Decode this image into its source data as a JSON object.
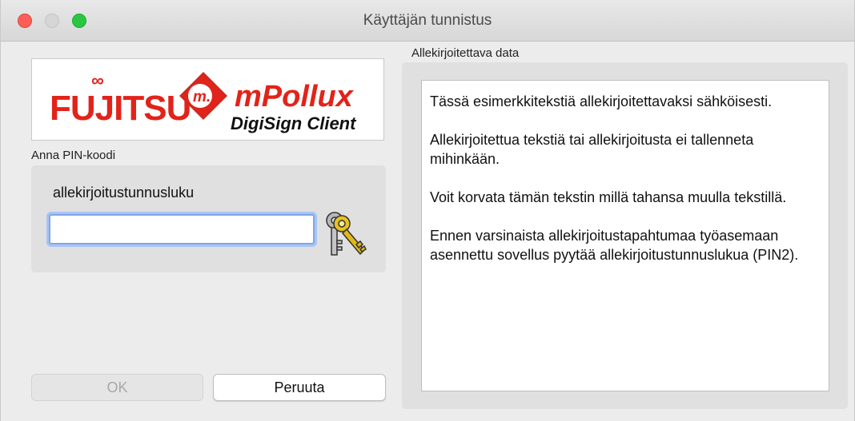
{
  "window": {
    "title": "Käyttäjän tunnistus"
  },
  "logo": {
    "fujitsu": "FUJITSU",
    "product_name": "mPollux",
    "product_sub": "DigiSign Client",
    "mark_letter": "m."
  },
  "pin": {
    "section_label": "Anna PIN-koodi",
    "field_label": "allekirjoitustunnusluku",
    "value": "",
    "placeholder": "",
    "icon": "keys-icon"
  },
  "buttons": {
    "ok_label": "OK",
    "cancel_label": "Peruuta"
  },
  "data": {
    "section_label": "Allekirjoitettava data",
    "paragraphs": [
      "Tässä esimerkkitekstiä allekirjoitettavaksi sähköisesti.",
      "Allekirjoitettua tekstiä tai allekirjoitusta ei tallenneta mihinkään.",
      "Voit korvata tämän tekstin millä tahansa muulla tekstillä.",
      "Ennen varsinaista allekirjoitustapahtumaa työasemaan asennettu sovellus pyytää allekirjoitustunnuslukua (PIN2)."
    ]
  },
  "colors": {
    "brand_red": "#e2231a",
    "focus_ring": "#7fa7e9",
    "close": "#fc5f57",
    "maximize": "#29c740"
  }
}
